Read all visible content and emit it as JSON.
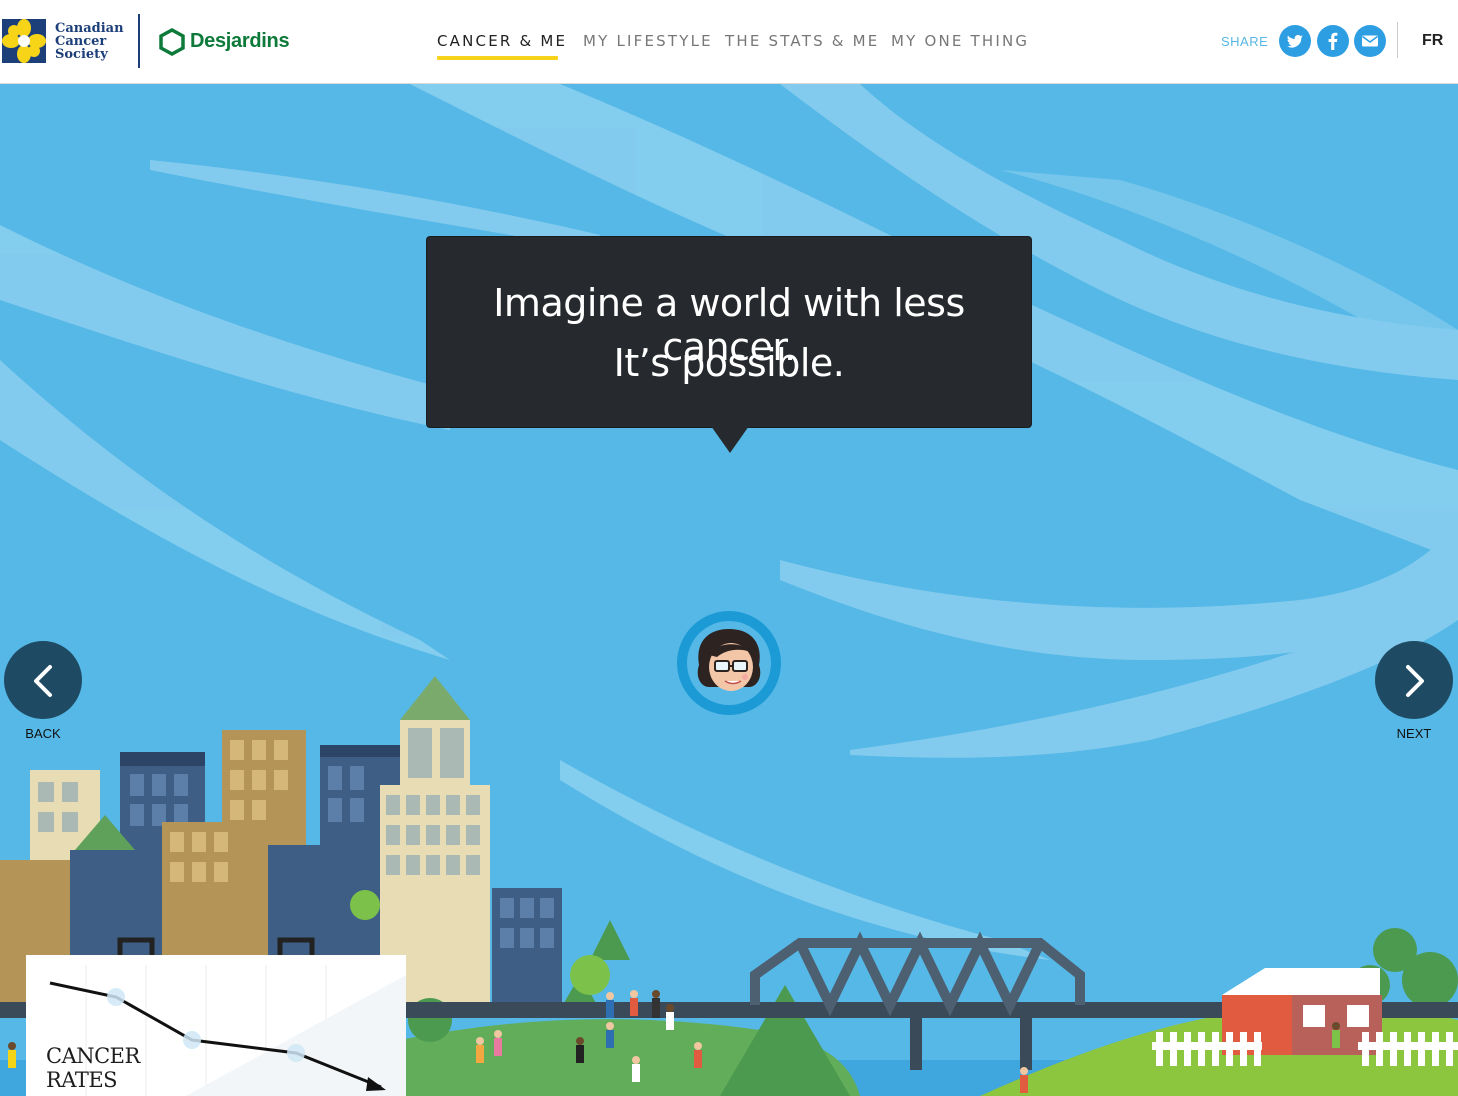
{
  "header": {
    "ccs_logo": {
      "icon": "daffodil-logo-icon",
      "lines": [
        "Canadian",
        "Cancer",
        "Society"
      ]
    },
    "desjardins": {
      "icon": "desjardins-hexagon-icon",
      "name": "Desjardins"
    },
    "nav": [
      {
        "label": "CANCER & ME",
        "active": true
      },
      {
        "label": "MY LIFESTYLE",
        "active": false
      },
      {
        "label": "THE STATS & ME",
        "active": false
      },
      {
        "label": "MY ONE THING",
        "active": false
      }
    ],
    "share_label": "SHARE",
    "share_buttons": [
      "twitter-icon",
      "facebook-icon",
      "email-icon"
    ],
    "language": "FR"
  },
  "hero": {
    "bubble_lines": [
      "Imagine a world with less cancer.",
      "It’s possible."
    ]
  },
  "navigation": {
    "back_label": "BACK",
    "next_label": "NEXT"
  },
  "chart_card": {
    "title_lines": [
      "CANCER",
      "RATES"
    ]
  },
  "colors": {
    "sky": "#56b8e6",
    "bubble": "#262a2e",
    "nav_underline": "#f6d21a",
    "nav_button": "#1e4b63",
    "share": "#2e9ee2",
    "desjardins_green": "#0d7a3a",
    "ccs_blue": "#1c3f7a"
  }
}
